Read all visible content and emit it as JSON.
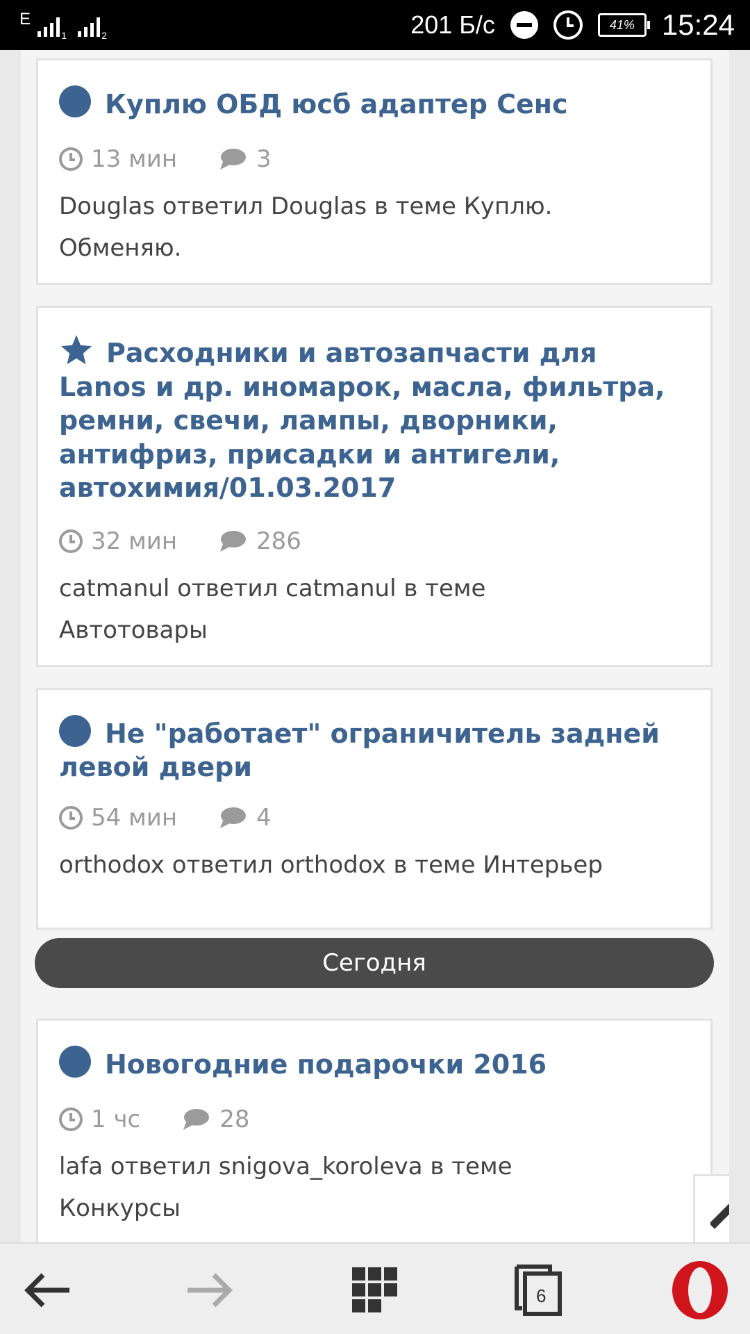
{
  "status_bar": {
    "network_letter": "E",
    "sim1_label": "1",
    "sim2_label": "2",
    "speed": "201 Б/с",
    "battery": "41%",
    "time": "15:24"
  },
  "topics": [
    {
      "title": "Куплю ОБД юсб адаптер Сенс",
      "icon": "circle-bullet",
      "time": "13 мин",
      "comments": "3",
      "desc_line1": "Douglas ответил Douglas в теме Куплю.",
      "desc_line2": "Обменяю."
    },
    {
      "title": "Расходники и автозапчасти для Lanos и др. иномарок, масла, фильтра, ремни, свечи, лампы, дворники, антифриз, присадки и антигели, автохимия/01.03.2017",
      "icon": "star",
      "time": "32 мин",
      "comments": "286",
      "desc_line1": "catmanul ответил catmanul в теме",
      "desc_line2": "Автотовары"
    },
    {
      "title": "Не \"работает\" ограничитель задней левой двери",
      "icon": "circle-bullet",
      "time": "54 мин",
      "comments": "4",
      "desc_line1": "orthodox ответил orthodox в теме Интерьер",
      "desc_line2": ""
    },
    {
      "title": "Новогодние подарочки 2016",
      "icon": "circle-bullet",
      "time": "1 чс",
      "comments": "28",
      "desc_line1": "lafa ответил snigova_koroleva в теме",
      "desc_line2": "Конкурсы"
    }
  ],
  "section_divider": "Сегодня",
  "browser_bar": {
    "tabs_count": "6"
  },
  "colors": {
    "accent": "#3d6490",
    "meta": "#9b9b9b",
    "divider": "#4a4a4a",
    "opera_red": "#d0141c"
  }
}
